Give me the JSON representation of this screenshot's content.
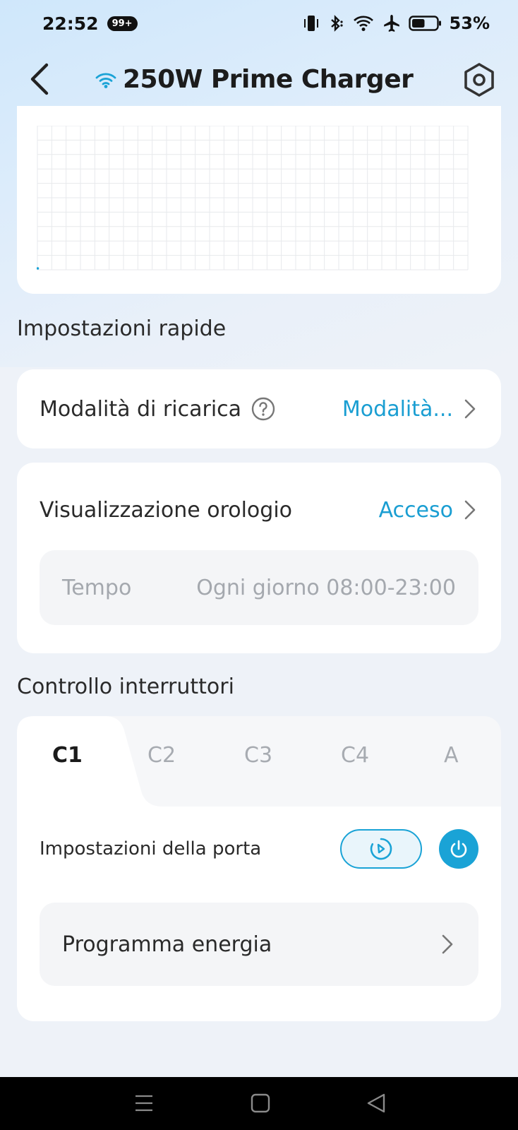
{
  "status_bar": {
    "time": "22:52",
    "badge": "99+",
    "battery_percent": "53%",
    "battery_level": 0.53,
    "icons": [
      "vibrate-icon",
      "bluetooth-icon",
      "wifi-icon",
      "airplane-icon",
      "battery-icon"
    ]
  },
  "header": {
    "title": "250W Prime Charger",
    "icons": [
      "back-icon",
      "wifi-icon",
      "settings-icon"
    ]
  },
  "quick_settings": {
    "section_title": "Impostazioni rapide",
    "charge_mode_label": "Modalità di ricarica",
    "charge_mode_value": "Modalità...",
    "clock_label": "Visualizzazione orologio",
    "clock_value": "Acceso",
    "time_label": "Tempo",
    "time_value": "Ogni giorno 08:00-23:00"
  },
  "switch_control": {
    "section_title": "Controllo interruttori",
    "tabs": [
      "C1",
      "C2",
      "C3",
      "C4",
      "A"
    ],
    "active_tab": "C1",
    "port_settings_label": "Impostazioni della porta",
    "energy_program_label": "Programma energia"
  },
  "colors": {
    "accent": "#1aa3d6",
    "link": "#1a9ed2",
    "text": "#2a2a2a",
    "muted": "#a4a8ae"
  }
}
